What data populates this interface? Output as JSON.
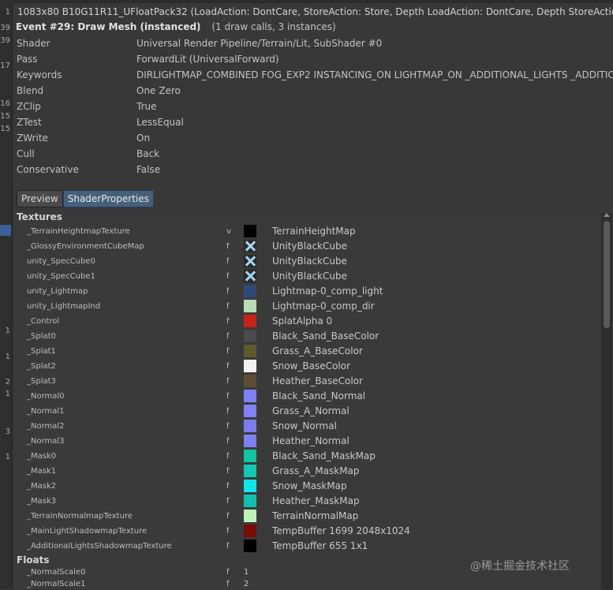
{
  "gutter_numbers": [
    "1",
    "39",
    "39",
    "17",
    "16",
    "15",
    "15",
    "1",
    "1",
    "2",
    "1",
    "3",
    "1"
  ],
  "header": {
    "resource": "1083x80 B10G11R11_UFloatPack32 (LoadAction: DontCare, StoreAction: Store, Depth LoadAction: DontCare, Depth StoreAction: Don",
    "event_title": "Event #29: Draw Mesh (instanced)",
    "event_calls": "(1 draw calls, 3 instances)"
  },
  "properties": [
    {
      "key": "Shader",
      "value": "Universal Render Pipeline/Terrain/Lit, SubShader #0"
    },
    {
      "key": "Pass",
      "value": "ForwardLit (UniversalForward)"
    },
    {
      "key": "Keywords",
      "value": "DIRLIGHTMAP_COMBINED FOG_EXP2 INSTANCING_ON LIGHTMAP_ON _ADDITIONAL_LIGHTS _ADDITION"
    },
    {
      "key": "Blend",
      "value": "One Zero"
    },
    {
      "key": "ZClip",
      "value": "True"
    },
    {
      "key": "ZTest",
      "value": "LessEqual"
    },
    {
      "key": "ZWrite",
      "value": "On"
    },
    {
      "key": "Cull",
      "value": "Back"
    },
    {
      "key": "Conservative",
      "value": "False"
    }
  ],
  "tabs": [
    {
      "label": "Preview",
      "active": false
    },
    {
      "label": "ShaderProperties",
      "active": true
    }
  ],
  "textures_heading": "Textures",
  "textures": [
    {
      "name": "_TerrainHeightmapTexture",
      "flag": "v",
      "color": "#000000",
      "cube": false,
      "value": "TerrainHeightMap"
    },
    {
      "name": "_GlossyEnvironmentCubeMap",
      "flag": "f",
      "color": "#2a2a2a",
      "cube": true,
      "value": "UnityBlackCube"
    },
    {
      "name": "unity_SpecCube0",
      "flag": "f",
      "color": "#2a2a2a",
      "cube": true,
      "value": "UnityBlackCube"
    },
    {
      "name": "unity_SpecCube1",
      "flag": "f",
      "color": "#2a2a2a",
      "cube": true,
      "value": "UnityBlackCube"
    },
    {
      "name": "unity_Lightmap",
      "flag": "f",
      "color": "#2e4a7a",
      "cube": false,
      "value": "Lightmap-0_comp_light"
    },
    {
      "name": "unity_LightmapInd",
      "flag": "f",
      "color": "#b9dcb4",
      "cube": false,
      "value": "Lightmap-0_comp_dir"
    },
    {
      "name": "_Control",
      "flag": "f",
      "color": "#c8221a",
      "cube": false,
      "value": "SplatAlpha 0"
    },
    {
      "name": "_Splat0",
      "flag": "f",
      "color": "#4b4b4b",
      "cube": false,
      "value": "Black_Sand_BaseColor"
    },
    {
      "name": "_Splat1",
      "flag": "f",
      "color": "#5f5a2c",
      "cube": false,
      "value": "Grass_A_BaseColor"
    },
    {
      "name": "_Splat2",
      "flag": "f",
      "color": "#f2f2f2",
      "cube": false,
      "value": "Snow_BaseColor"
    },
    {
      "name": "_Splat3",
      "flag": "f",
      "color": "#5c4e34",
      "cube": false,
      "value": "Heather_BaseColor"
    },
    {
      "name": "_Normal0",
      "flag": "f",
      "color": "#7f7ff6",
      "cube": false,
      "value": "Black_Sand_Normal"
    },
    {
      "name": "_Normal1",
      "flag": "f",
      "color": "#8080f8",
      "cube": false,
      "value": "Grass_A_Normal"
    },
    {
      "name": "_Normal2",
      "flag": "f",
      "color": "#7c7cee",
      "cube": false,
      "value": "Snow_Normal"
    },
    {
      "name": "_Normal3",
      "flag": "f",
      "color": "#7f80f4",
      "cube": false,
      "value": "Heather_Normal"
    },
    {
      "name": "_Mask0",
      "flag": "f",
      "color": "#11c6a0",
      "cube": false,
      "value": "Black_Sand_MaskMap"
    },
    {
      "name": "_Mask1",
      "flag": "f",
      "color": "#12c8b2",
      "cube": false,
      "value": "Grass_A_MaskMap"
    },
    {
      "name": "_Mask2",
      "flag": "f",
      "color": "#0fe6ea",
      "cube": false,
      "value": "Snow_MaskMap"
    },
    {
      "name": "_Mask3",
      "flag": "f",
      "color": "#11c0b0",
      "cube": false,
      "value": "Heather_MaskMap"
    },
    {
      "name": "_TerrainNormalmapTexture",
      "flag": "f",
      "color": "#bff0b8",
      "cube": false,
      "value": "TerrainNormalMap"
    },
    {
      "name": "_MainLightShadowmapTexture",
      "flag": "f",
      "color": "#7a0c08",
      "cube": false,
      "value": "TempBuffer 1699 2048x1024"
    },
    {
      "name": "_AdditionalLightsShadowmapTexture",
      "flag": "f",
      "color": "#000000",
      "cube": false,
      "value": "TempBuffer 655 1x1"
    }
  ],
  "floats_heading": "Floats",
  "floats": [
    {
      "name": "_NormalScale0",
      "flag": "f",
      "value": "1"
    },
    {
      "name": "_NormalScale1",
      "flag": "f",
      "value": "2"
    }
  ],
  "watermark": "@稀土掘金技术社区"
}
